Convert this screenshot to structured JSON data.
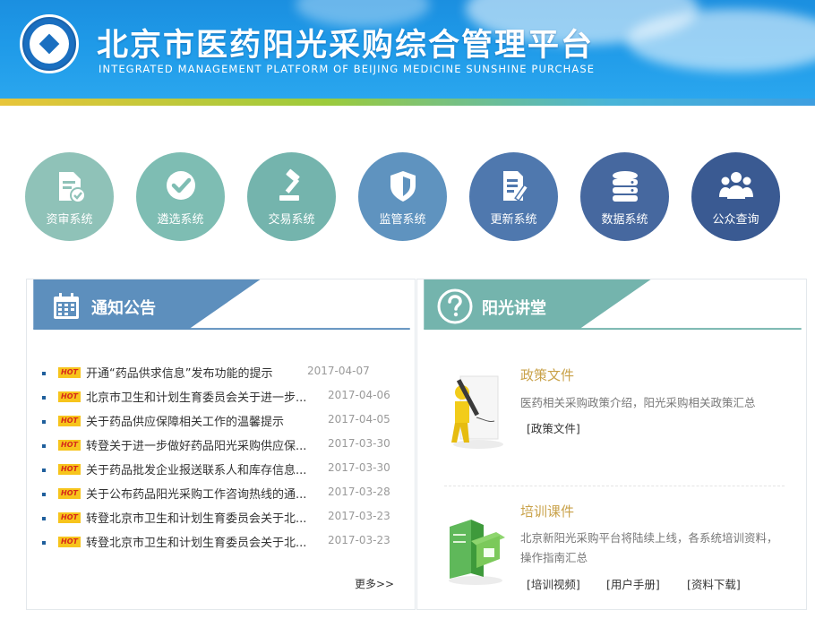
{
  "header": {
    "title_cn": "北京市医药阳光采购综合管理平台",
    "title_en": "INTEGRATED MANAGEMENT PLATFORM OF BEIJING MEDICINE SUNSHINE PURCHASE"
  },
  "nav": [
    {
      "label": "资审系统",
      "icon": "document-check-icon",
      "color": "#8fc2b8"
    },
    {
      "label": "遴选系统",
      "icon": "check-circle-icon",
      "color": "#7ebdb3"
    },
    {
      "label": "交易系统",
      "icon": "gavel-icon",
      "color": "#74b4ad"
    },
    {
      "label": "监管系统",
      "icon": "shield-icon",
      "color": "#5f93bf"
    },
    {
      "label": "更新系统",
      "icon": "edit-document-icon",
      "color": "#4f78ae"
    },
    {
      "label": "数据系统",
      "icon": "database-icon",
      "color": "#46689f"
    },
    {
      "label": "公众查询",
      "icon": "users-icon",
      "color": "#3a5a92"
    }
  ],
  "notices": {
    "title": "通知公告",
    "hot_label": "HOT",
    "items": [
      {
        "title": "开通“药品供求信息”发布功能的提示",
        "date": "2017-04-07"
      },
      {
        "title": "北京市卫生和计划生育委员会关于进一步...",
        "date": "2017-04-06"
      },
      {
        "title": "关于药品供应保障相关工作的温馨提示",
        "date": "2017-04-05"
      },
      {
        "title": "转登关于进一步做好药品阳光采购供应保...",
        "date": "2017-03-30"
      },
      {
        "title": "关于药品批发企业报送联系人和库存信息...",
        "date": "2017-03-30"
      },
      {
        "title": "关于公布药品阳光采购工作咨询热线的通...",
        "date": "2017-03-28"
      },
      {
        "title": "转登北京市卫生和计划生育委员会关于北...",
        "date": "2017-03-23"
      },
      {
        "title": "转登北京市卫生和计划生育委员会关于北...",
        "date": "2017-03-23"
      }
    ],
    "more": "更多>>"
  },
  "lecture": {
    "title": "阳光讲堂",
    "policy": {
      "title": "政策文件",
      "desc": "医药相关采购政策介绍，阳光采购相关政策汇总",
      "links": [
        "[政策文件]"
      ]
    },
    "training": {
      "title": "培训课件",
      "desc": "北京新阳光采购平台将陆续上线，各系统培训资料，操作指南汇总",
      "links": [
        "[培训视频]",
        "[用户手册]",
        "[资料下载]"
      ]
    }
  },
  "colors": {
    "notice_head": "#5d8fbd",
    "lecture_head": "#74b4ad",
    "hot_bg": "#f7c41c",
    "gold_text": "#c9a24a"
  }
}
